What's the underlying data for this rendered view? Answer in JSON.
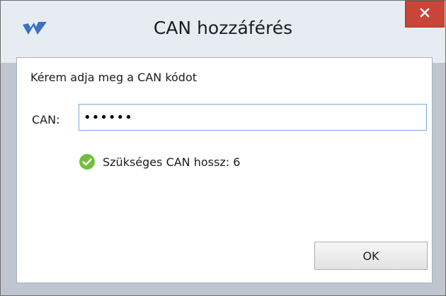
{
  "window": {
    "title": "CAN hozzáférés",
    "close_label": "✕"
  },
  "form": {
    "instruction": "Kérem adja meg a CAN kódot",
    "can_label": "CAN:",
    "can_value": "123456",
    "status_text": "Szükséges CAN hossz: 6",
    "ok_label": "OK"
  },
  "colors": {
    "close_button": "#c84538",
    "status_ok": "#6fbf3c",
    "input_border": "#7aa7e0"
  },
  "icons": {
    "app": "app-logo-icon",
    "close": "close-icon",
    "status": "check-circle-icon"
  }
}
